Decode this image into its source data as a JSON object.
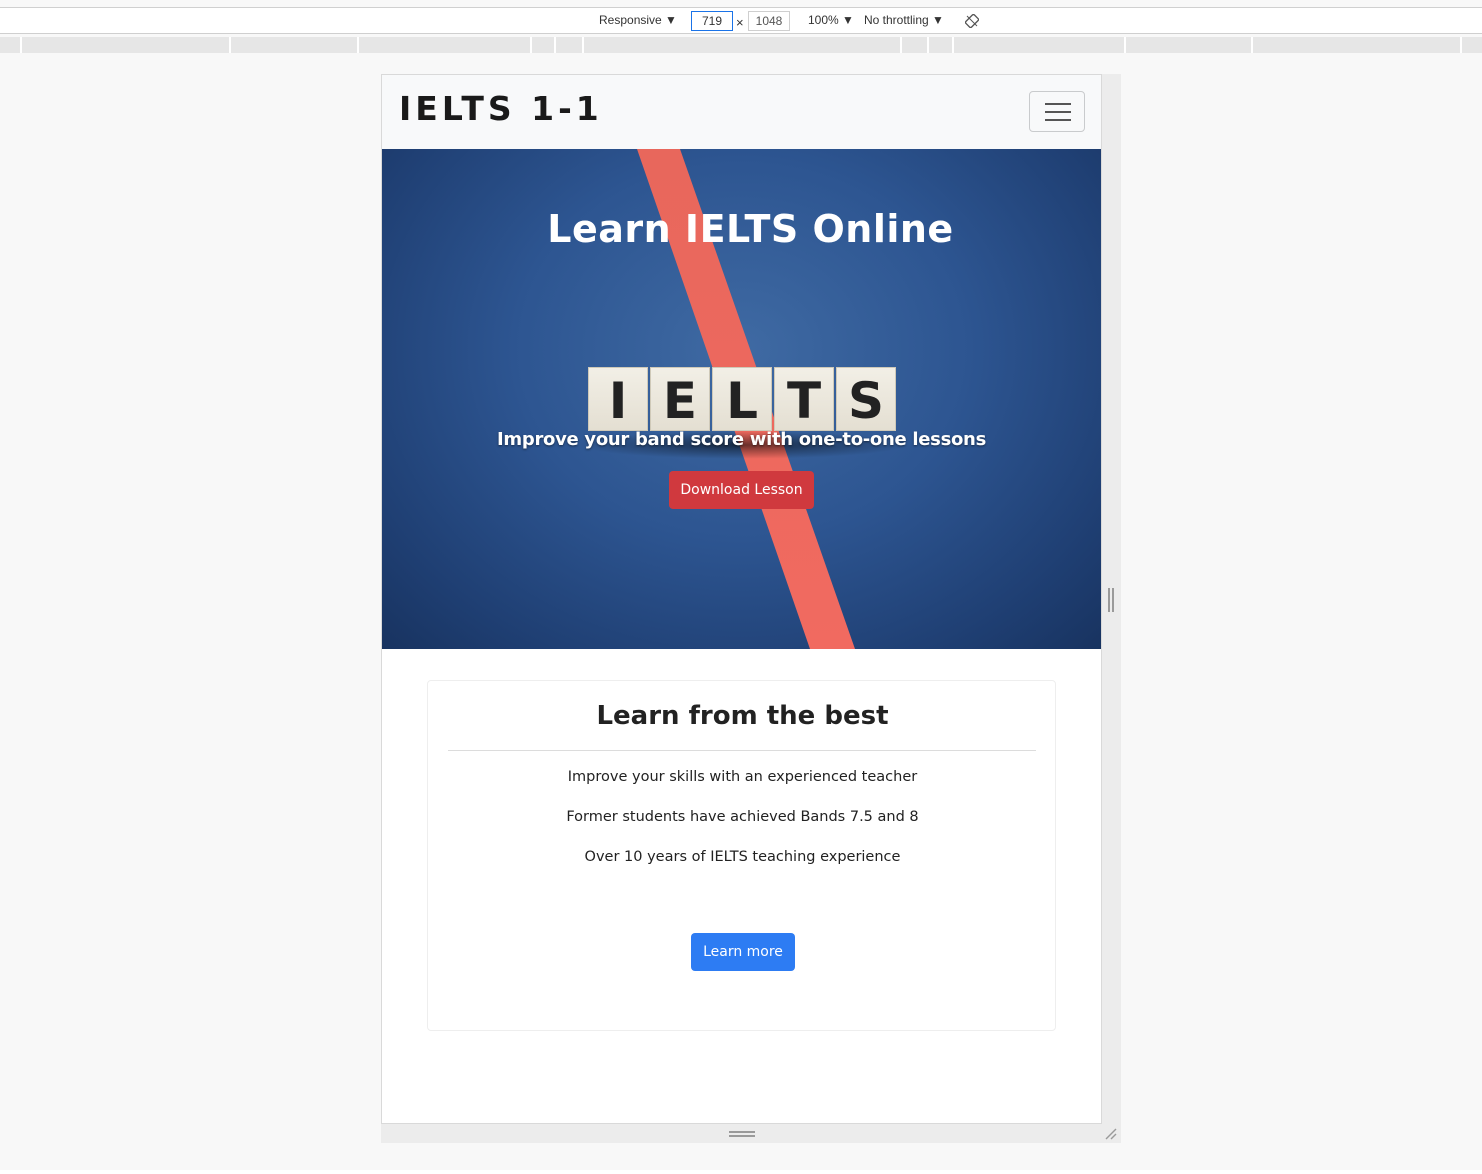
{
  "devtools": {
    "device_label": "Responsive ▼",
    "width_value": "719",
    "height_value": "1048",
    "times": "×",
    "zoom_label": "100% ▼",
    "throttling_label": "No throttling ▼",
    "rotate_icon": "rotate-icon"
  },
  "site": {
    "brand": "IELTS 1-1",
    "menu_icon": "hamburger-icon",
    "hero": {
      "title": "Learn IELTS Online",
      "tiles": [
        "I",
        "E",
        "L",
        "T",
        "S"
      ],
      "subtitle": "Improve your band score with one-to-one lessons",
      "button_label": "Download Lesson"
    },
    "card": {
      "title": "Learn from the best",
      "lines": [
        "Improve your skills with an experienced teacher",
        "Former students have achieved Bands 7.5 and 8",
        "Over 10 years of IELTS teaching experience"
      ],
      "button_label": "Learn more"
    }
  },
  "colors": {
    "hero_blue": "#2d5591",
    "stripe_red": "#f0685f",
    "download_button": "#d0393e",
    "learn_more_button": "#2d7cf3",
    "navbar_bg": "#f8f9fa"
  }
}
